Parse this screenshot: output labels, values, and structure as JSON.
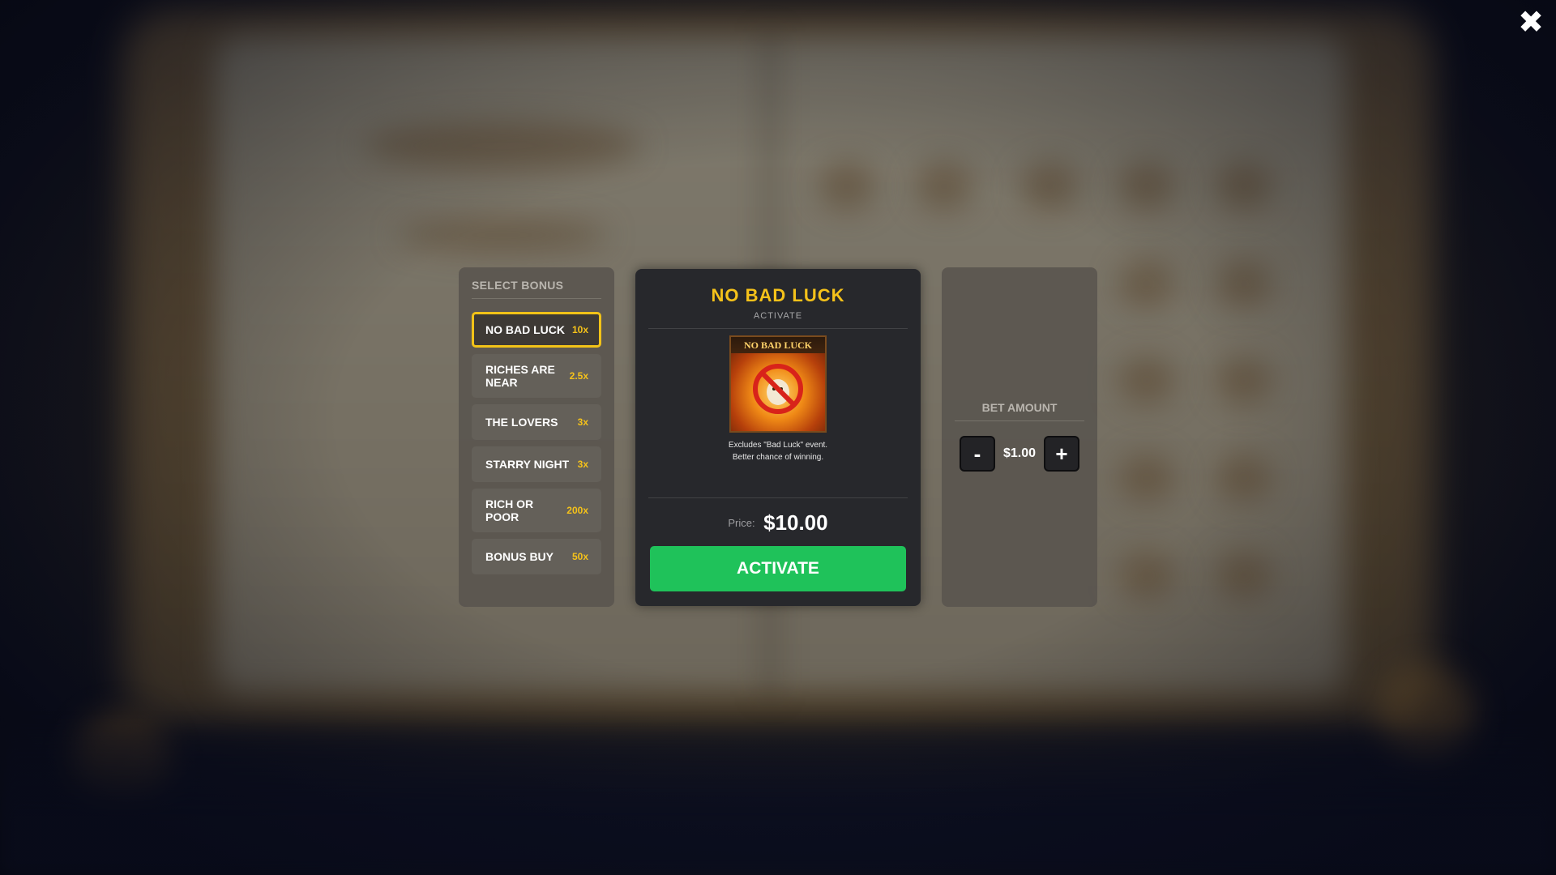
{
  "colors": {
    "accent": "#f5c21a",
    "activate_button": "#1fc25a",
    "selected_border": "#f2c318"
  },
  "close_icon": "close-icon",
  "bonus_panel": {
    "heading": "SELECT BONUS",
    "items": [
      {
        "label": "NO BAD LUCK",
        "multiplier": "10x",
        "selected": true
      },
      {
        "label": "RICHES ARE NEAR",
        "multiplier": "2.5x",
        "selected": false
      },
      {
        "label": "THE LOVERS",
        "multiplier": "3x",
        "selected": false
      },
      {
        "label": "STARRY NIGHT",
        "multiplier": "3x",
        "selected": false
      },
      {
        "label": "RICH OR POOR",
        "multiplier": "200x",
        "selected": false
      },
      {
        "label": "BONUS BUY",
        "multiplier": "50x",
        "selected": false
      }
    ]
  },
  "card": {
    "title": "NO BAD LUCK",
    "subtitle": "ACTIVATE",
    "art_banner": "NO BAD LUCK",
    "description_line1": "Excludes \"Bad Luck\" event.",
    "description_line2": "Better chance of winning.",
    "price_label": "Price:",
    "price_value": "$10.00",
    "activate_label": "ACTIVATE"
  },
  "bet_panel": {
    "heading": "BET AMOUNT",
    "decrease_label": "-",
    "value": "$1.00",
    "increase_label": "+"
  }
}
